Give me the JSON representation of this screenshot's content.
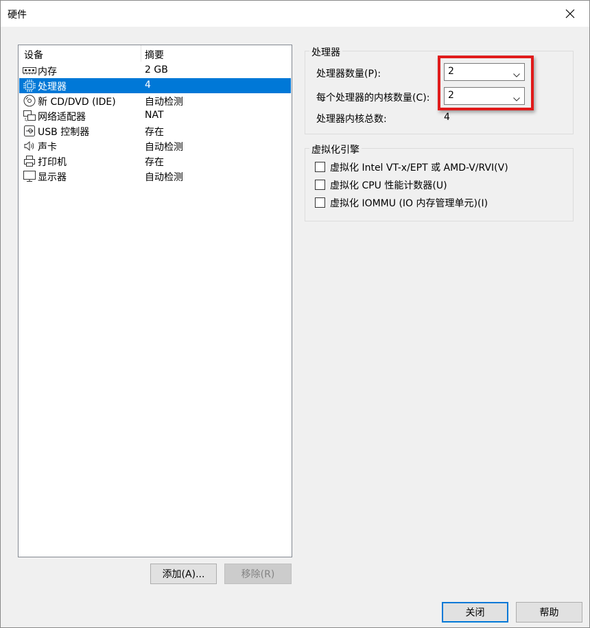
{
  "window": {
    "title": "硬件"
  },
  "device_list": {
    "headers": {
      "device": "设备",
      "summary": "摘要"
    },
    "items": [
      {
        "name": "内存",
        "summary": "2 GB",
        "icon": "memory-icon",
        "selected": false
      },
      {
        "name": "处理器",
        "summary": "4",
        "icon": "processor-icon",
        "selected": true
      },
      {
        "name": "新 CD/DVD (IDE)",
        "summary": "自动检测",
        "icon": "cd-dvd-icon",
        "selected": false
      },
      {
        "name": "网络适配器",
        "summary": "NAT",
        "icon": "network-adapter-icon",
        "selected": false
      },
      {
        "name": "USB 控制器",
        "summary": "存在",
        "icon": "usb-icon",
        "selected": false
      },
      {
        "name": "声卡",
        "summary": "自动检测",
        "icon": "speaker-icon",
        "selected": false
      },
      {
        "name": "打印机",
        "summary": "存在",
        "icon": "printer-icon",
        "selected": false
      },
      {
        "name": "显示器",
        "summary": "自动检测",
        "icon": "monitor-icon",
        "selected": false
      }
    ]
  },
  "buttons": {
    "add": "添加(A)...",
    "remove": "移除(R)",
    "close": "关闭",
    "help": "帮助"
  },
  "processor": {
    "legend": "处理器",
    "count_label": "处理器数量(P):",
    "count_value": "2",
    "cores_label": "每个处理器的内核数量(C):",
    "cores_value": "2",
    "total_label": "处理器内核总数:",
    "total_value": "4"
  },
  "virtualization": {
    "legend": "虚拟化引擎",
    "options": [
      {
        "label": "虚拟化 Intel VT-x/EPT 或 AMD-V/RVI(V)",
        "checked": false
      },
      {
        "label": "虚拟化 CPU 性能计数器(U)",
        "checked": false
      },
      {
        "label": "虚拟化 IOMMU (IO 内存管理单元)(I)",
        "checked": false
      }
    ]
  },
  "colors": {
    "selection": "#0078d7",
    "highlight": "#e01b1b"
  }
}
